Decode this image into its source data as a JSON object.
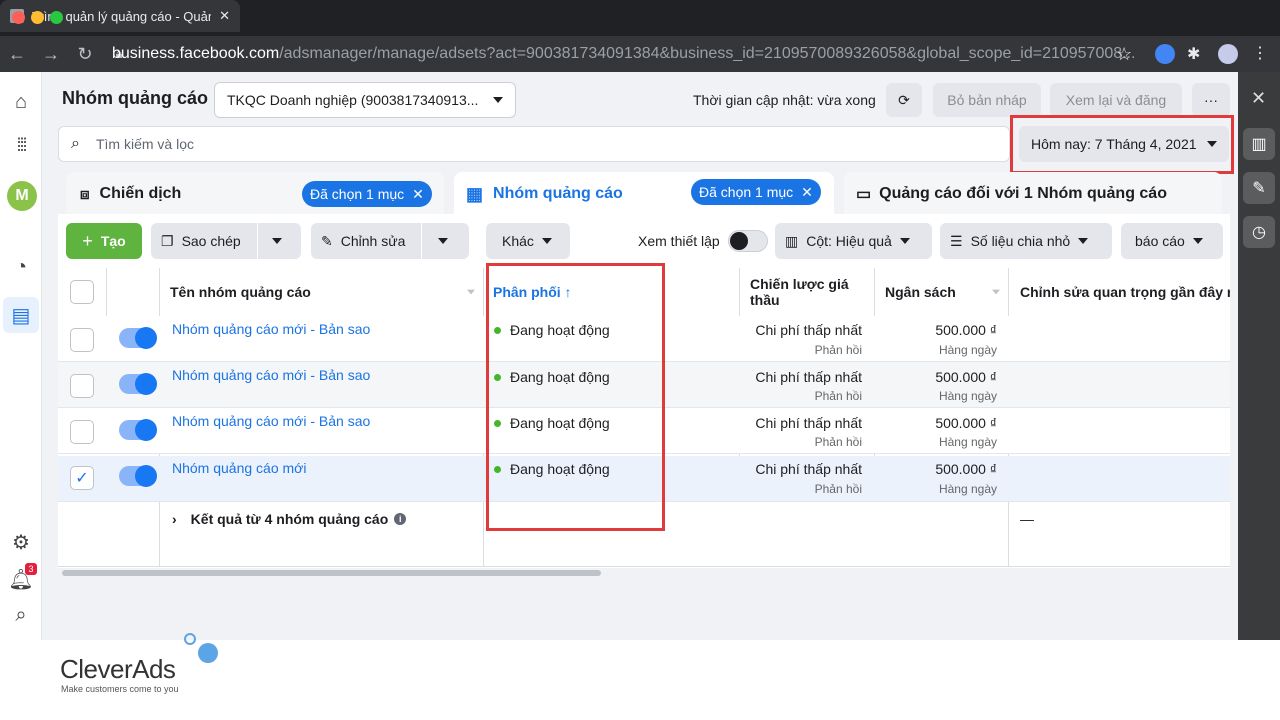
{
  "browser": {
    "tab_title": "Trình quản lý quảng cáo - Quản",
    "url_host": "business.facebook.com",
    "url_path": "/adsmanager/manage/adsets?act=900381734091384&business_id=2109570089326058&global_scope_id=210957008..."
  },
  "header": {
    "page_title": "Nhóm quảng cáo",
    "account_selector": "TKQC Doanh nghiệp (9003817340913...",
    "update_status": "Thời gian cập nhật: vừa xong",
    "discard_label": "Bỏ bản nháp",
    "review_label": "Xem lại và đăng",
    "more_label": "···"
  },
  "search": {
    "placeholder": "Tìm kiếm và lọc"
  },
  "date_picker": {
    "label": "Hôm nay: 7 Tháng 4, 2021"
  },
  "tabs": [
    {
      "label": "Chiến dịch",
      "chip": "Đã chọn 1 mục"
    },
    {
      "label": "Nhóm quảng cáo",
      "chip": "Đã chọn 1 mục"
    },
    {
      "label": "Quảng cáo đối với 1 Nhóm quảng cáo"
    }
  ],
  "toolbar": {
    "create": "Tạo",
    "copy": "Sao chép",
    "edit": "Chỉnh sửa",
    "other": "Khác",
    "view_setup": "Xem thiết lập",
    "columns": "Cột: Hiệu quả",
    "breakdown": "Số liệu chia nhỏ",
    "reports": "báo cáo"
  },
  "table": {
    "headers": {
      "name": "Tên nhóm quảng cáo",
      "delivery": "Phân phối ↑",
      "bid_strategy_1": "Chiến lược giá",
      "bid_strategy_2": "thầu",
      "budget": "Ngân sách",
      "recent_edits": "Chỉnh sửa quan trọng gần đây nh"
    },
    "rows": [
      {
        "name": "Nhóm quảng cáo mới - Bản sao",
        "delivery": "Đang hoạt động",
        "bid": "Chi phí thấp nhất",
        "bid_sub": "Phản hồi",
        "budget": "500.000 ₫",
        "budget_sub": "Hàng ngày",
        "checked": false
      },
      {
        "name": "Nhóm quảng cáo mới - Bản sao",
        "delivery": "Đang hoạt động",
        "bid": "Chi phí thấp nhất",
        "bid_sub": "Phản hồi",
        "budget": "500.000 ₫",
        "budget_sub": "Hàng ngày",
        "checked": false
      },
      {
        "name": "Nhóm quảng cáo mới - Bản sao",
        "delivery": "Đang hoạt động",
        "bid": "Chi phí thấp nhất",
        "bid_sub": "Phản hồi",
        "budget": "500.000 ₫",
        "budget_sub": "Hàng ngày",
        "checked": false
      },
      {
        "name": "Nhóm quảng cáo mới",
        "delivery": "Đang hoạt động",
        "bid": "Chi phí thấp nhất",
        "bid_sub": "Phản hồi",
        "budget": "500.000 ₫",
        "budget_sub": "Hàng ngày",
        "checked": true
      }
    ],
    "summary": "Kết quả từ 4 nhóm quảng cáo",
    "summary_dash": "—"
  },
  "notifications_badge": "3",
  "avatar_letter": "M",
  "logo": {
    "name": "CleverAds",
    "tagline": "Make customers come to you"
  },
  "colors": {
    "accent": "#1b74e4",
    "create_green": "#5fb33f",
    "highlight_red": "#e03a3a"
  }
}
